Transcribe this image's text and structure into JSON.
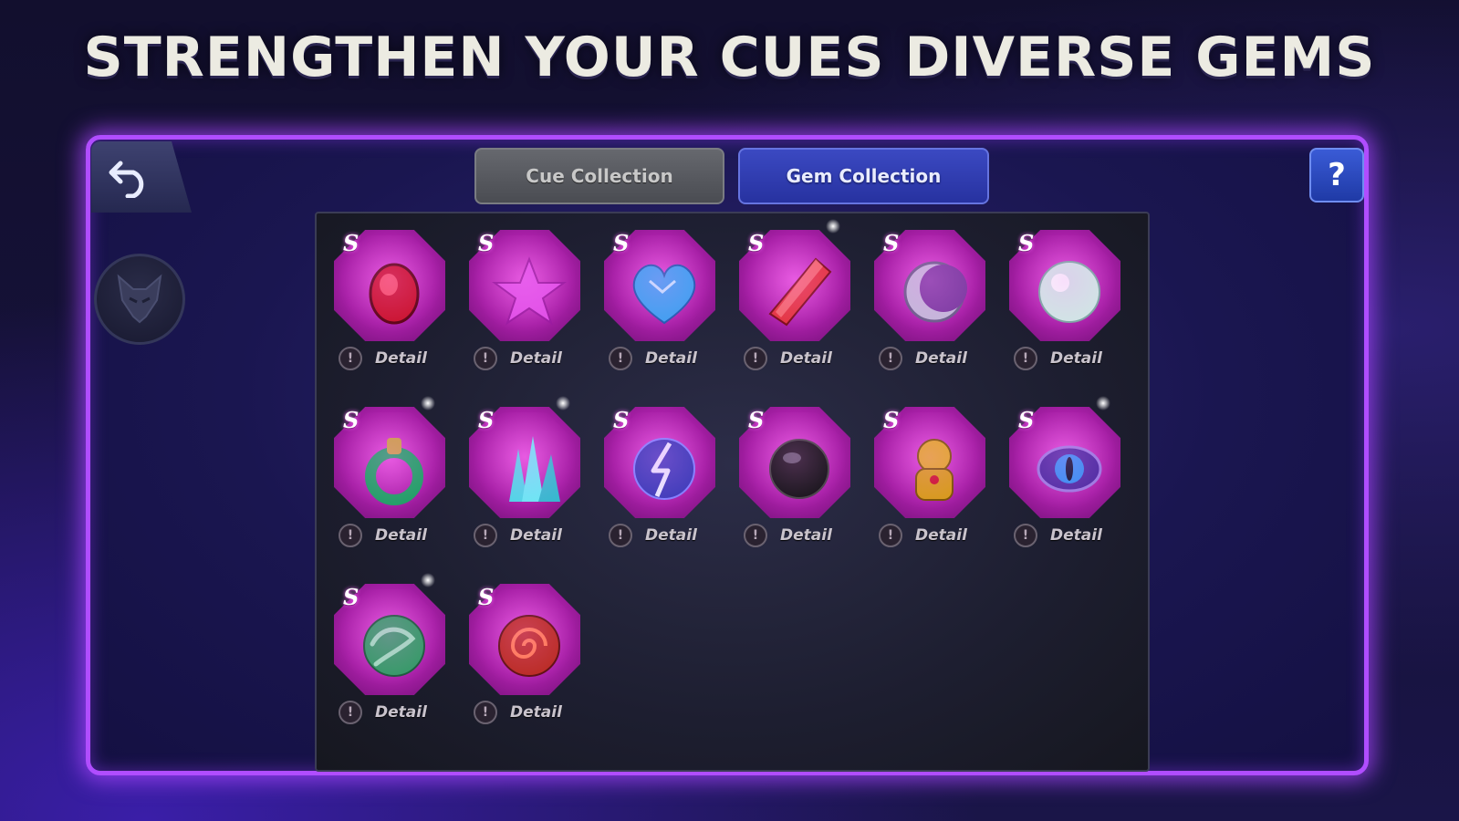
{
  "headline": "STRENGTHEN YOUR CUES DIVERSE GEMS",
  "tabs": {
    "cue": "Cue Collection",
    "gem": "Gem Collection",
    "active": "gem"
  },
  "help_label": "?",
  "gems": [
    {
      "grade": "S",
      "detail": "Detail",
      "icon": "red-ruby-gem-icon"
    },
    {
      "grade": "S",
      "detail": "Detail",
      "icon": "pink-star-gem-icon"
    },
    {
      "grade": "S",
      "detail": "Detail",
      "icon": "blue-heart-gem-icon"
    },
    {
      "grade": "S",
      "detail": "Detail",
      "icon": "red-crystal-shard-icon"
    },
    {
      "grade": "S",
      "detail": "Detail",
      "icon": "crescent-moon-gem-icon"
    },
    {
      "grade": "S",
      "detail": "Detail",
      "icon": "white-pearl-gem-icon"
    },
    {
      "grade": "S",
      "detail": "Detail",
      "icon": "jade-ring-gem-icon"
    },
    {
      "grade": "S",
      "detail": "Detail",
      "icon": "cyan-crystal-cluster-icon"
    },
    {
      "grade": "S",
      "detail": "Detail",
      "icon": "lightning-orb-gem-icon"
    },
    {
      "grade": "S",
      "detail": "Detail",
      "icon": "black-pearl-gem-icon"
    },
    {
      "grade": "S",
      "detail": "Detail",
      "icon": "golden-lion-figure-icon"
    },
    {
      "grade": "S",
      "detail": "Detail",
      "icon": "dragon-eye-gem-icon"
    },
    {
      "grade": "S",
      "detail": "Detail",
      "icon": "jade-dragon-gem-icon"
    },
    {
      "grade": "S",
      "detail": "Detail",
      "icon": "red-rose-gem-icon"
    }
  ]
}
